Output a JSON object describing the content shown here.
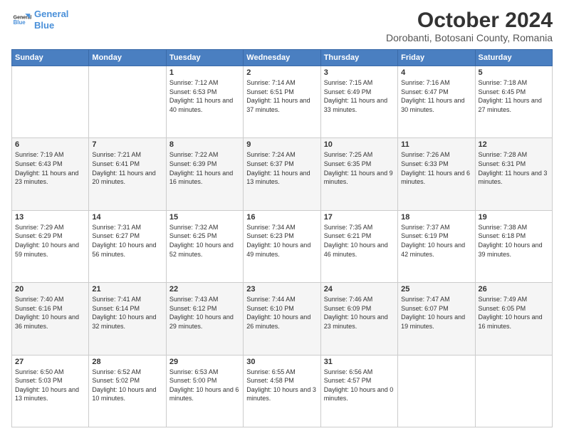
{
  "header": {
    "logo_line1": "General",
    "logo_line2": "Blue",
    "title": "October 2024",
    "subtitle": "Dorobanti, Botosani County, Romania"
  },
  "calendar": {
    "days_of_week": [
      "Sunday",
      "Monday",
      "Tuesday",
      "Wednesday",
      "Thursday",
      "Friday",
      "Saturday"
    ],
    "weeks": [
      [
        {
          "day": "",
          "text": ""
        },
        {
          "day": "",
          "text": ""
        },
        {
          "day": "1",
          "text": "Sunrise: 7:12 AM\nSunset: 6:53 PM\nDaylight: 11 hours and 40 minutes."
        },
        {
          "day": "2",
          "text": "Sunrise: 7:14 AM\nSunset: 6:51 PM\nDaylight: 11 hours and 37 minutes."
        },
        {
          "day": "3",
          "text": "Sunrise: 7:15 AM\nSunset: 6:49 PM\nDaylight: 11 hours and 33 minutes."
        },
        {
          "day": "4",
          "text": "Sunrise: 7:16 AM\nSunset: 6:47 PM\nDaylight: 11 hours and 30 minutes."
        },
        {
          "day": "5",
          "text": "Sunrise: 7:18 AM\nSunset: 6:45 PM\nDaylight: 11 hours and 27 minutes."
        }
      ],
      [
        {
          "day": "6",
          "text": "Sunrise: 7:19 AM\nSunset: 6:43 PM\nDaylight: 11 hours and 23 minutes."
        },
        {
          "day": "7",
          "text": "Sunrise: 7:21 AM\nSunset: 6:41 PM\nDaylight: 11 hours and 20 minutes."
        },
        {
          "day": "8",
          "text": "Sunrise: 7:22 AM\nSunset: 6:39 PM\nDaylight: 11 hours and 16 minutes."
        },
        {
          "day": "9",
          "text": "Sunrise: 7:24 AM\nSunset: 6:37 PM\nDaylight: 11 hours and 13 minutes."
        },
        {
          "day": "10",
          "text": "Sunrise: 7:25 AM\nSunset: 6:35 PM\nDaylight: 11 hours and 9 minutes."
        },
        {
          "day": "11",
          "text": "Sunrise: 7:26 AM\nSunset: 6:33 PM\nDaylight: 11 hours and 6 minutes."
        },
        {
          "day": "12",
          "text": "Sunrise: 7:28 AM\nSunset: 6:31 PM\nDaylight: 11 hours and 3 minutes."
        }
      ],
      [
        {
          "day": "13",
          "text": "Sunrise: 7:29 AM\nSunset: 6:29 PM\nDaylight: 10 hours and 59 minutes."
        },
        {
          "day": "14",
          "text": "Sunrise: 7:31 AM\nSunset: 6:27 PM\nDaylight: 10 hours and 56 minutes."
        },
        {
          "day": "15",
          "text": "Sunrise: 7:32 AM\nSunset: 6:25 PM\nDaylight: 10 hours and 52 minutes."
        },
        {
          "day": "16",
          "text": "Sunrise: 7:34 AM\nSunset: 6:23 PM\nDaylight: 10 hours and 49 minutes."
        },
        {
          "day": "17",
          "text": "Sunrise: 7:35 AM\nSunset: 6:21 PM\nDaylight: 10 hours and 46 minutes."
        },
        {
          "day": "18",
          "text": "Sunrise: 7:37 AM\nSunset: 6:19 PM\nDaylight: 10 hours and 42 minutes."
        },
        {
          "day": "19",
          "text": "Sunrise: 7:38 AM\nSunset: 6:18 PM\nDaylight: 10 hours and 39 minutes."
        }
      ],
      [
        {
          "day": "20",
          "text": "Sunrise: 7:40 AM\nSunset: 6:16 PM\nDaylight: 10 hours and 36 minutes."
        },
        {
          "day": "21",
          "text": "Sunrise: 7:41 AM\nSunset: 6:14 PM\nDaylight: 10 hours and 32 minutes."
        },
        {
          "day": "22",
          "text": "Sunrise: 7:43 AM\nSunset: 6:12 PM\nDaylight: 10 hours and 29 minutes."
        },
        {
          "day": "23",
          "text": "Sunrise: 7:44 AM\nSunset: 6:10 PM\nDaylight: 10 hours and 26 minutes."
        },
        {
          "day": "24",
          "text": "Sunrise: 7:46 AM\nSunset: 6:09 PM\nDaylight: 10 hours and 23 minutes."
        },
        {
          "day": "25",
          "text": "Sunrise: 7:47 AM\nSunset: 6:07 PM\nDaylight: 10 hours and 19 minutes."
        },
        {
          "day": "26",
          "text": "Sunrise: 7:49 AM\nSunset: 6:05 PM\nDaylight: 10 hours and 16 minutes."
        }
      ],
      [
        {
          "day": "27",
          "text": "Sunrise: 6:50 AM\nSunset: 5:03 PM\nDaylight: 10 hours and 13 minutes."
        },
        {
          "day": "28",
          "text": "Sunrise: 6:52 AM\nSunset: 5:02 PM\nDaylight: 10 hours and 10 minutes."
        },
        {
          "day": "29",
          "text": "Sunrise: 6:53 AM\nSunset: 5:00 PM\nDaylight: 10 hours and 6 minutes."
        },
        {
          "day": "30",
          "text": "Sunrise: 6:55 AM\nSunset: 4:58 PM\nDaylight: 10 hours and 3 minutes."
        },
        {
          "day": "31",
          "text": "Sunrise: 6:56 AM\nSunset: 4:57 PM\nDaylight: 10 hours and 0 minutes."
        },
        {
          "day": "",
          "text": ""
        },
        {
          "day": "",
          "text": ""
        }
      ]
    ]
  }
}
